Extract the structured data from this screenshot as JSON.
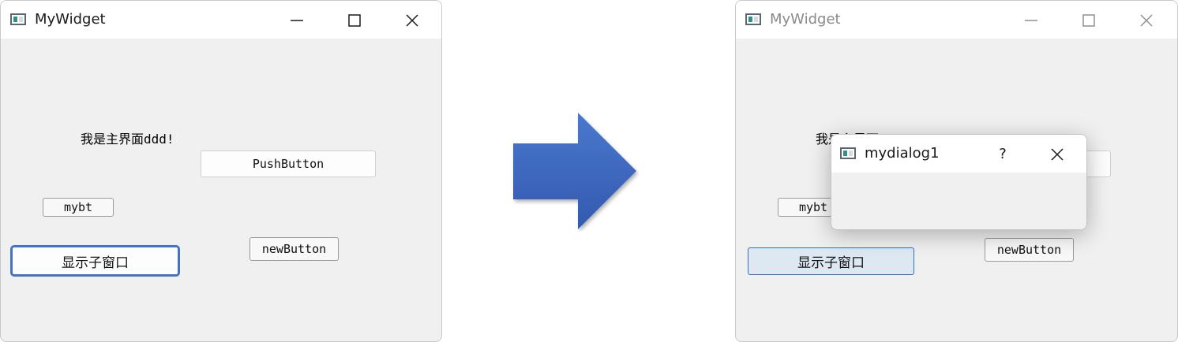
{
  "before": {
    "title": "MyWidget",
    "label": "我是主界面ddd!",
    "buttons": {
      "push": "PushButton",
      "mybt": "mybt",
      "show_child": "显示子窗口",
      "new": "newButton"
    }
  },
  "after": {
    "title": "MyWidget",
    "label": "我是主界面ddd!",
    "buttons": {
      "mybt": "mybt",
      "show_child": "显示子窗口",
      "new": "newButton"
    },
    "dialog": {
      "title": "mydialog1",
      "help_label": "?"
    }
  },
  "colors": {
    "arrow_top": "#4a78cc",
    "arrow_bottom": "#3259b0",
    "focus_border": "#4472c4",
    "pressed_bg": "#dde8f3"
  },
  "icons": {
    "app": "app-window-icon",
    "minimize": "minimize-icon",
    "maximize": "maximize-icon",
    "close": "close-icon",
    "arrow": "right-arrow-icon"
  }
}
